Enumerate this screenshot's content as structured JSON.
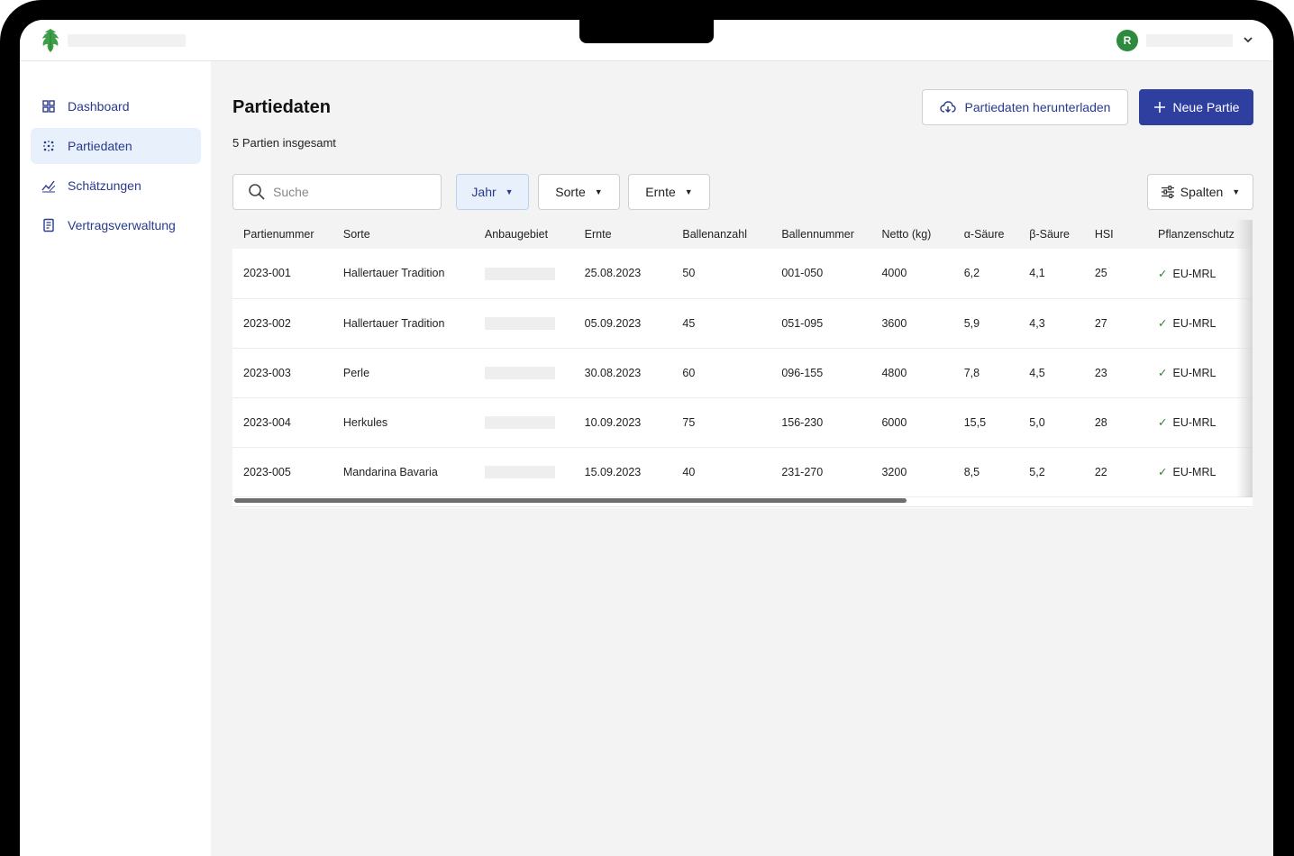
{
  "nav": {
    "items": [
      {
        "label": "Dashboard",
        "icon": "grid-icon"
      },
      {
        "label": "Partiedaten",
        "icon": "dots-icon",
        "active": true
      },
      {
        "label": "Schätzungen",
        "icon": "chart-icon"
      },
      {
        "label": "Vertragsverwaltung",
        "icon": "document-icon"
      }
    ]
  },
  "user": {
    "avatar_letter": "R"
  },
  "page": {
    "title": "Partiedaten",
    "subtitle": "5 Partien insgesamt",
    "download_label": "Partiedaten herunterladen",
    "new_label": "Neue Partie"
  },
  "search": {
    "placeholder": "Suche"
  },
  "filters": {
    "year": "Jahr",
    "variety": "Sorte",
    "harvest": "Ernte",
    "columns": "Spalten"
  },
  "table": {
    "headers": [
      "Partienummer",
      "Sorte",
      "Anbaugebiet",
      "Ernte",
      "Ballenanzahl",
      "Ballennummer",
      "Netto (kg)",
      "α-Säure",
      "β-Säure",
      "HSI",
      "Pflanzenschutz"
    ],
    "rows": [
      [
        "2023-001",
        "Hallertauer Tradition",
        "",
        "25.08.2023",
        "50",
        "001-050",
        "4000",
        "6,2",
        "4,1",
        "25",
        "EU-MRL"
      ],
      [
        "2023-002",
        "Hallertauer Tradition",
        "",
        "05.09.2023",
        "45",
        "051-095",
        "3600",
        "5,9",
        "4,3",
        "27",
        "EU-MRL"
      ],
      [
        "2023-003",
        "Perle",
        "",
        "30.08.2023",
        "60",
        "096-155",
        "4800",
        "7,8",
        "4,5",
        "23",
        "EU-MRL"
      ],
      [
        "2023-004",
        "Herkules",
        "",
        "10.09.2023",
        "75",
        "156-230",
        "6000",
        "15,5",
        "5,0",
        "28",
        "EU-MRL"
      ],
      [
        "2023-005",
        "Mandarina Bavaria",
        "",
        "15.09.2023",
        "40",
        "231-270",
        "3200",
        "8,5",
        "5,2",
        "22",
        "EU-MRL"
      ]
    ]
  },
  "colors": {
    "primary": "#2f3fa0",
    "nav_text": "#2a3a8c",
    "active_bg": "#e8f1fb",
    "avatar": "#2e8b3e",
    "check": "#2e7d32"
  }
}
